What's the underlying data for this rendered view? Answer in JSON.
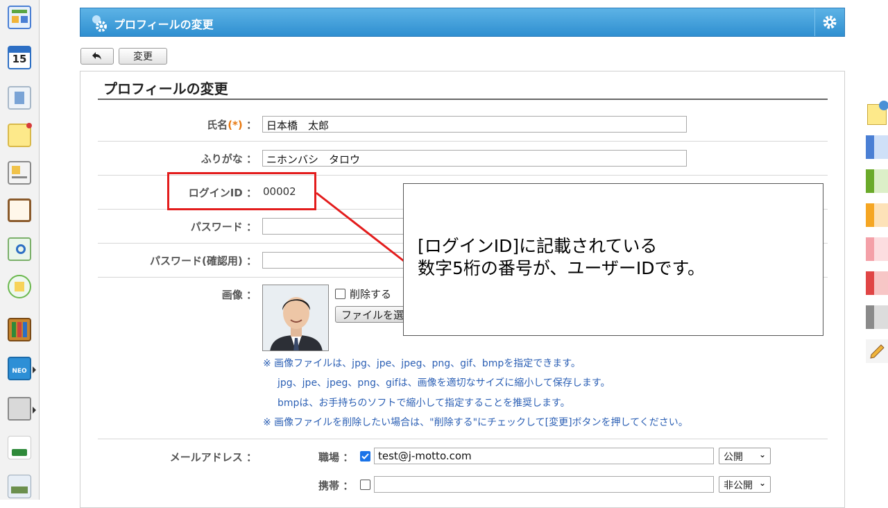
{
  "header": {
    "title": "プロフィールの変更"
  },
  "toolbar": {
    "back_icon": "back-arrow-icon",
    "change_label": "変更"
  },
  "form": {
    "section_title": "プロフィールの変更",
    "name": {
      "label": "氏名",
      "required": "(*)",
      "colon": "：",
      "value": "日本橋　太郎"
    },
    "furigana": {
      "label": "ふりがな",
      "colon": "：",
      "value": "ニホンバシ　タロウ"
    },
    "login_id": {
      "label": "ログインID",
      "colon": "：",
      "value": "00002"
    },
    "password": {
      "label": "パスワード",
      "colon": "：",
      "value": ""
    },
    "password_confirm": {
      "label": "パスワード(確認用)",
      "colon": "：",
      "value": ""
    },
    "image": {
      "label": "画像",
      "colon": "：",
      "delete_label": "削除する",
      "file_button": "ファイルを選択",
      "notes": [
        "※ 画像ファイルは、jpg、jpe、jpeg、png、gif、bmpを指定できます。",
        "jpg、jpe、jpeg、png、gifは、画像を適切なサイズに縮小して保存します。",
        "bmpは、お手持ちのソフトで縮小して指定することを推奨します。",
        "※ 画像ファイルを削除したい場合は、\"削除する\"にチェックして[変更]ボタンを押してください。"
      ]
    },
    "email": {
      "label": "メールアドレス",
      "colon": "：",
      "work": {
        "label": "職場",
        "colon": "：",
        "checked": true,
        "value": "test@j-motto.com",
        "visibility": "公開"
      },
      "mobile": {
        "label": "携帯",
        "colon": "：",
        "checked": false,
        "value": "",
        "visibility": "非公開"
      }
    }
  },
  "callout": {
    "line1": "[ログインID]に記載されている",
    "line2": "数字5桁の番号が、ユーザーIDです。"
  },
  "colors": {
    "header_blue": "#2f8fd0",
    "highlight_red": "#e31c1c",
    "note_blue": "#2b5fb4",
    "required_orange": "#e8780f",
    "palette": [
      "#4a7fd4",
      "#6aaa2a",
      "#f5a623",
      "#f4a0a8",
      "#e04545",
      "#8a8a8a"
    ]
  },
  "sidebar": {
    "icons": [
      "portal-icon",
      "calendar-icon",
      "facility-icon",
      "memo-icon",
      "bulletin-icon",
      "clipboard-icon",
      "survey-icon",
      "workflow-icon",
      "cabinet-icon",
      "neo-icon",
      "folder-icon",
      "tanomeru-icon",
      "news-icon"
    ],
    "calendar_day": "15",
    "neo_text": "NEO"
  }
}
